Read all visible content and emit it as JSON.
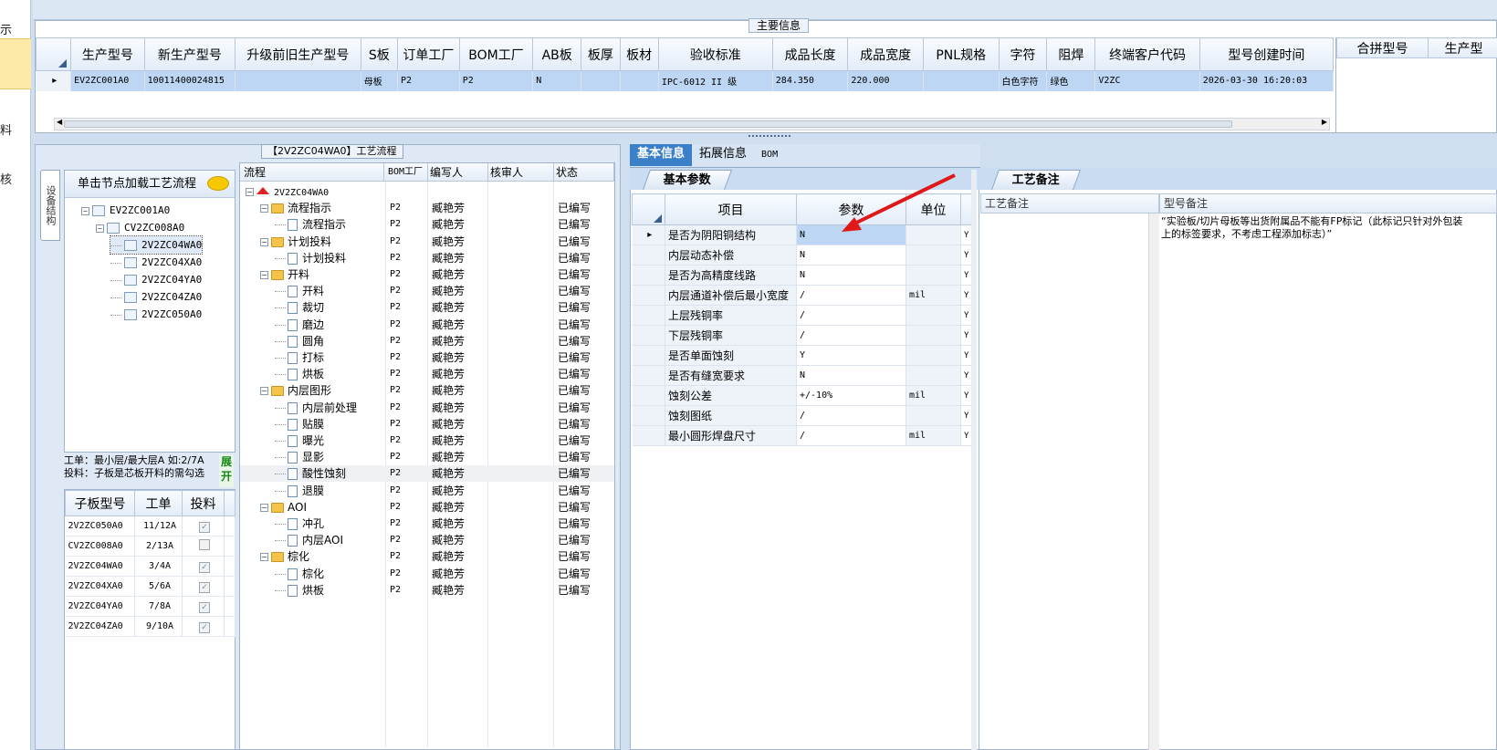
{
  "left_strip": {
    "labels": [
      "示",
      "料",
      "核"
    ]
  },
  "main_info": {
    "legend": "主要信息",
    "columns": [
      "生产型号",
      "新生产型号",
      "升级前旧生产型号",
      "S板",
      "订单工厂",
      "BOM工厂",
      "AB板",
      "板厚",
      "板材",
      "验收标准",
      "成品长度",
      "成品宽度",
      "PNL规格",
      "字符",
      "阻焊",
      "终端客户代码",
      "型号创建时间"
    ],
    "row": {
      "c0": "EV2ZC001A0",
      "c1": "10011400024815",
      "c2": "",
      "c3": "母板",
      "c4": "P2",
      "c5": "P2",
      "c6": "N",
      "c7": "",
      "c8": "",
      "c9": "IPC-6012 II 级",
      "c10": "284.350",
      "c11": "220.000",
      "c12": "",
      "c13": "白色字符",
      "c14": "绿色",
      "c15": "V2ZC",
      "c16": "2026-03-30 16:20:03"
    },
    "right_columns": [
      "合拼型号",
      "生产型"
    ]
  },
  "flow_section": {
    "legend": "【2V2ZC04WA0】工艺流程",
    "side_tab": "设备结构",
    "tree_header": "单击节点加载工艺流程",
    "tree": [
      {
        "label": "EV2ZC001A0"
      },
      {
        "label": "CV2ZC008A0"
      },
      {
        "label": "2V2ZC04WA0"
      },
      {
        "label": "2V2ZC04XA0"
      },
      {
        "label": "2V2ZC04YA0"
      },
      {
        "label": "2V2ZC04ZA0"
      },
      {
        "label": "2V2ZC050A0"
      }
    ],
    "note_line1": "工单：最小层/最大层A 如:2/7A",
    "note_line2": "投料：子板是芯板开料的需勾选",
    "expand_label": "展开",
    "sub_table": {
      "headers": [
        "子板型号",
        "工单",
        "投料"
      ],
      "rows": [
        {
          "model": "2V2ZC050A0",
          "order": "11/12A",
          "checked": true
        },
        {
          "model": "CV2ZC008A0",
          "order": "2/13A",
          "checked": false
        },
        {
          "model": "2V2ZC04WA0",
          "order": "3/4A",
          "checked": true
        },
        {
          "model": "2V2ZC04XA0",
          "order": "5/6A",
          "checked": true
        },
        {
          "model": "2V2ZC04YA0",
          "order": "7/8A",
          "checked": true
        },
        {
          "model": "2V2ZC04ZA0",
          "order": "9/10A",
          "checked": true
        }
      ]
    },
    "flow_table": {
      "headers": [
        "流程",
        "BOM工厂",
        "编写人",
        "核审人",
        "状态"
      ],
      "rows": [
        {
          "level": 0,
          "type": "root",
          "name": "2V2ZC04WA0",
          "bom": "",
          "writer": "",
          "auditor": "",
          "status": ""
        },
        {
          "level": 1,
          "type": "folder",
          "name": "流程指示",
          "bom": "P2",
          "writer": "臧艳芳",
          "auditor": "",
          "status": "已编写"
        },
        {
          "level": 2,
          "type": "doc",
          "name": "流程指示",
          "bom": "P2",
          "writer": "臧艳芳",
          "auditor": "",
          "status": "已编写"
        },
        {
          "level": 1,
          "type": "folder",
          "name": "计划投料",
          "bom": "P2",
          "writer": "臧艳芳",
          "auditor": "",
          "status": "已编写"
        },
        {
          "level": 2,
          "type": "doc",
          "name": "计划投料",
          "bom": "P2",
          "writer": "臧艳芳",
          "auditor": "",
          "status": "已编写"
        },
        {
          "level": 1,
          "type": "folder",
          "name": "开料",
          "bom": "P2",
          "writer": "臧艳芳",
          "auditor": "",
          "status": "已编写"
        },
        {
          "level": 2,
          "type": "doc",
          "name": "开料",
          "bom": "P2",
          "writer": "臧艳芳",
          "auditor": "",
          "status": "已编写"
        },
        {
          "level": 2,
          "type": "doc",
          "name": "裁切",
          "bom": "P2",
          "writer": "臧艳芳",
          "auditor": "",
          "status": "已编写"
        },
        {
          "level": 2,
          "type": "doc",
          "name": "磨边",
          "bom": "P2",
          "writer": "臧艳芳",
          "auditor": "",
          "status": "已编写"
        },
        {
          "level": 2,
          "type": "doc",
          "name": "圆角",
          "bom": "P2",
          "writer": "臧艳芳",
          "auditor": "",
          "status": "已编写"
        },
        {
          "level": 2,
          "type": "doc",
          "name": "打标",
          "bom": "P2",
          "writer": "臧艳芳",
          "auditor": "",
          "status": "已编写"
        },
        {
          "level": 2,
          "type": "doc",
          "name": "烘板",
          "bom": "P2",
          "writer": "臧艳芳",
          "auditor": "",
          "status": "已编写"
        },
        {
          "level": 1,
          "type": "folder",
          "name": "内层图形",
          "bom": "P2",
          "writer": "臧艳芳",
          "auditor": "",
          "status": "已编写"
        },
        {
          "level": 2,
          "type": "doc",
          "name": "内层前处理",
          "bom": "P2",
          "writer": "臧艳芳",
          "auditor": "",
          "status": "已编写"
        },
        {
          "level": 2,
          "type": "doc",
          "name": "贴膜",
          "bom": "P2",
          "writer": "臧艳芳",
          "auditor": "",
          "status": "已编写"
        },
        {
          "level": 2,
          "type": "doc",
          "name": "曝光",
          "bom": "P2",
          "writer": "臧艳芳",
          "auditor": "",
          "status": "已编写"
        },
        {
          "level": 2,
          "type": "doc",
          "name": "显影",
          "bom": "P2",
          "writer": "臧艳芳",
          "auditor": "",
          "status": "已编写"
        },
        {
          "level": 2,
          "type": "doc",
          "name": "酸性蚀刻",
          "bom": "P2",
          "writer": "臧艳芳",
          "auditor": "",
          "status": "已编写",
          "selected": true
        },
        {
          "level": 2,
          "type": "doc",
          "name": "退膜",
          "bom": "P2",
          "writer": "臧艳芳",
          "auditor": "",
          "status": "已编写"
        },
        {
          "level": 1,
          "type": "folder",
          "name": "AOI",
          "bom": "P2",
          "writer": "臧艳芳",
          "auditor": "",
          "status": "已编写"
        },
        {
          "level": 2,
          "type": "doc",
          "name": "冲孔",
          "bom": "P2",
          "writer": "臧艳芳",
          "auditor": "",
          "status": "已编写"
        },
        {
          "level": 2,
          "type": "doc",
          "name": "内层AOI",
          "bom": "P2",
          "writer": "臧艳芳",
          "auditor": "",
          "status": "已编写"
        },
        {
          "level": 1,
          "type": "folder",
          "name": "棕化",
          "bom": "P2",
          "writer": "臧艳芳",
          "auditor": "",
          "status": "已编写"
        },
        {
          "level": 2,
          "type": "doc",
          "name": "棕化",
          "bom": "P2",
          "writer": "臧艳芳",
          "auditor": "",
          "status": "已编写"
        },
        {
          "level": 2,
          "type": "doc",
          "name": "烘板",
          "bom": "P2",
          "writer": "臧艳芳",
          "auditor": "",
          "status": "已编写"
        }
      ]
    }
  },
  "detail": {
    "tabs": [
      "基本信息",
      "拓展信息",
      "BOM"
    ],
    "sub_tab": "基本参数",
    "param_headers": [
      "项目",
      "参数",
      "单位"
    ],
    "params": [
      {
        "item": "是否为阴阳铜结构",
        "value": "N",
        "unit": "",
        "flag": "Y"
      },
      {
        "item": "内层动态补偿",
        "value": "N",
        "unit": "",
        "flag": "Y"
      },
      {
        "item": "是否为高精度线路",
        "value": "N",
        "unit": "",
        "flag": "Y"
      },
      {
        "item": "内层通道补偿后最小宽度",
        "value": "/",
        "unit": "mil",
        "flag": "Y"
      },
      {
        "item": "上层残铜率",
        "value": "/",
        "unit": "",
        "flag": "Y"
      },
      {
        "item": "下层残铜率",
        "value": "/",
        "unit": "",
        "flag": "Y"
      },
      {
        "item": "是否单面蚀刻",
        "value": "Y",
        "unit": "",
        "flag": "Y"
      },
      {
        "item": "是否有缝宽要求",
        "value": "N",
        "unit": "",
        "flag": "Y"
      },
      {
        "item": "蚀刻公差",
        "value": "+/-10%",
        "unit": "mil",
        "flag": "Y"
      },
      {
        "item": "蚀刻图纸",
        "value": "/",
        "unit": "",
        "flag": "Y"
      },
      {
        "item": "最小圆形焊盘尺寸",
        "value": "/",
        "unit": "mil",
        "flag": "Y"
      }
    ]
  },
  "remarks": {
    "sub_tab": "工艺备注",
    "col1": "工艺备注",
    "col2": "型号备注",
    "text_line1": "“实验板/切片母板等出货附属品不能有FP标记（此标记只针对外包装",
    "text_line2": "上的标签要求，不考虑工程添加标志）”"
  },
  "colors": {
    "selection": "#bcd6f3",
    "accent": "#3a80c9",
    "arrow": "#e01818"
  }
}
